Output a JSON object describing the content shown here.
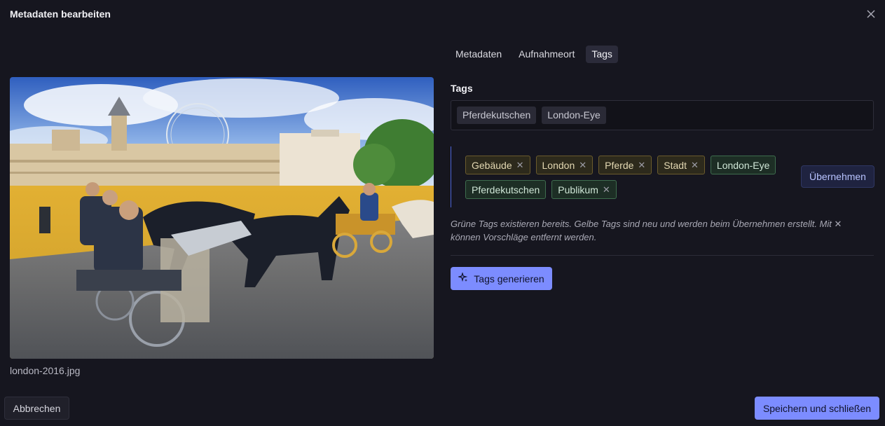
{
  "dialog": {
    "title": "Metadaten bearbeiten",
    "close_icon": "close-icon"
  },
  "tabs": [
    {
      "label": "Metadaten",
      "active": false
    },
    {
      "label": "Aufnahmeort",
      "active": false
    },
    {
      "label": "Tags",
      "active": true
    }
  ],
  "image": {
    "filename": "london-2016.jpg"
  },
  "tags": {
    "label": "Tags",
    "current": [
      "Pferdekutschen",
      "London-Eye"
    ]
  },
  "suggestions": {
    "items": [
      {
        "label": "Gebäude",
        "status": "new"
      },
      {
        "label": "London",
        "status": "new"
      },
      {
        "label": "Pferde",
        "status": "new"
      },
      {
        "label": "Stadt",
        "status": "new"
      },
      {
        "label": "London-Eye",
        "status": "existing"
      },
      {
        "label": "Pferdekutschen",
        "status": "existing"
      },
      {
        "label": "Publikum",
        "status": "existing"
      }
    ],
    "apply_label": "Übernehmen",
    "hint": "Grüne Tags existieren bereits. Gelbe Tags sind neu und werden beim Übernehmen erstellt. Mit ✕ können Vorschläge entfernt werden."
  },
  "generate": {
    "label": "Tags generieren",
    "icon": "sparkles-icon"
  },
  "footer": {
    "cancel_label": "Abbrechen",
    "save_label": "Speichern und schließen"
  },
  "colors": {
    "accent": "#7c8cff",
    "new_tag": "#6b5b2c",
    "existing_tag": "#3e6d4e"
  }
}
